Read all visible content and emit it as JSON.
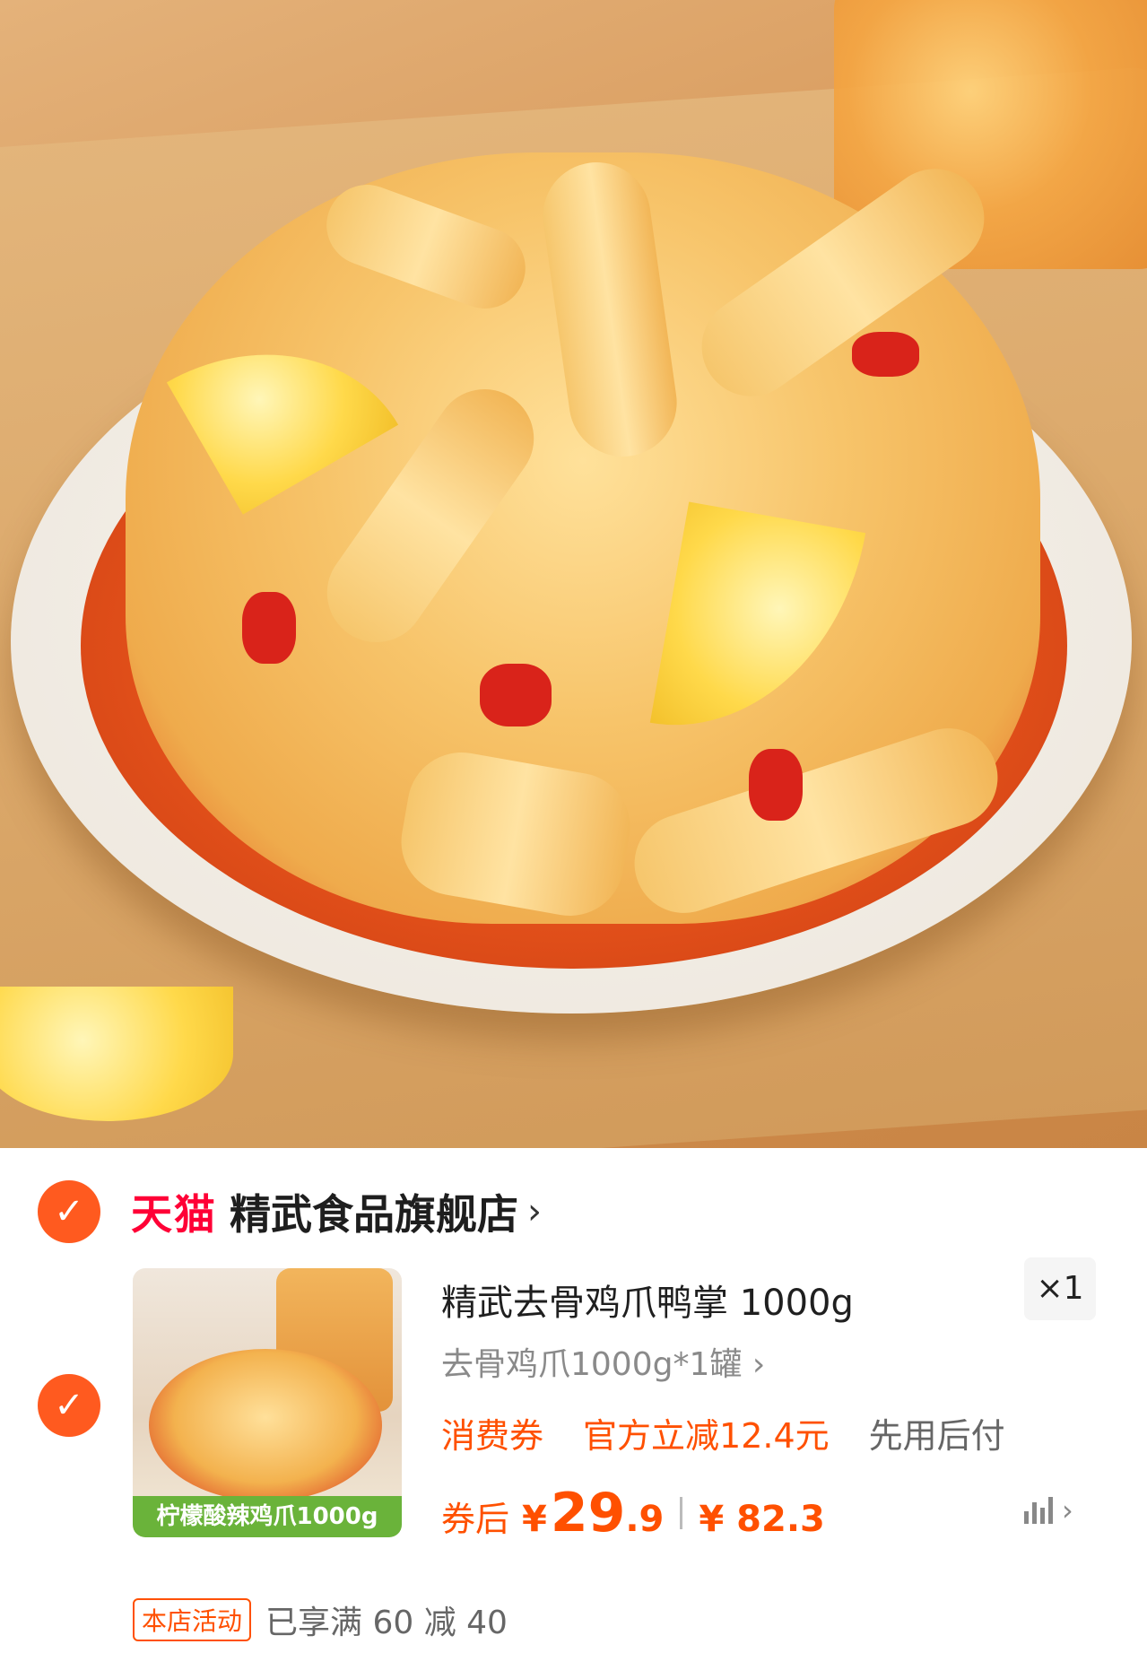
{
  "hero": {
    "image": "lemon-spicy-chicken-feet-photo"
  },
  "store": {
    "platform": "天猫",
    "name": "精武食品旗舰店",
    "chevron_icon": "chevron-right-icon"
  },
  "item": {
    "thumbnail_label": "柠檬酸辣鸡爪1000g",
    "title": "精武去骨鸡爪鸭掌 1000g",
    "quantity": "×1",
    "sku": "去骨鸡爪1000g*1罐 ›",
    "promos": [
      "消费券",
      "官方立减12.4元",
      "先用后付"
    ],
    "price_label": "券后",
    "currency": "¥",
    "price_int": "29",
    "price_dec": ".9",
    "original_price": "¥ 82.3",
    "detail_chevron": "›"
  },
  "activity": {
    "tag": "本店活动",
    "text": "已享满 60 减 40"
  },
  "colors": {
    "accent": "#ff5000",
    "tmall": "#ff0036",
    "check": "#ff5a1f"
  }
}
